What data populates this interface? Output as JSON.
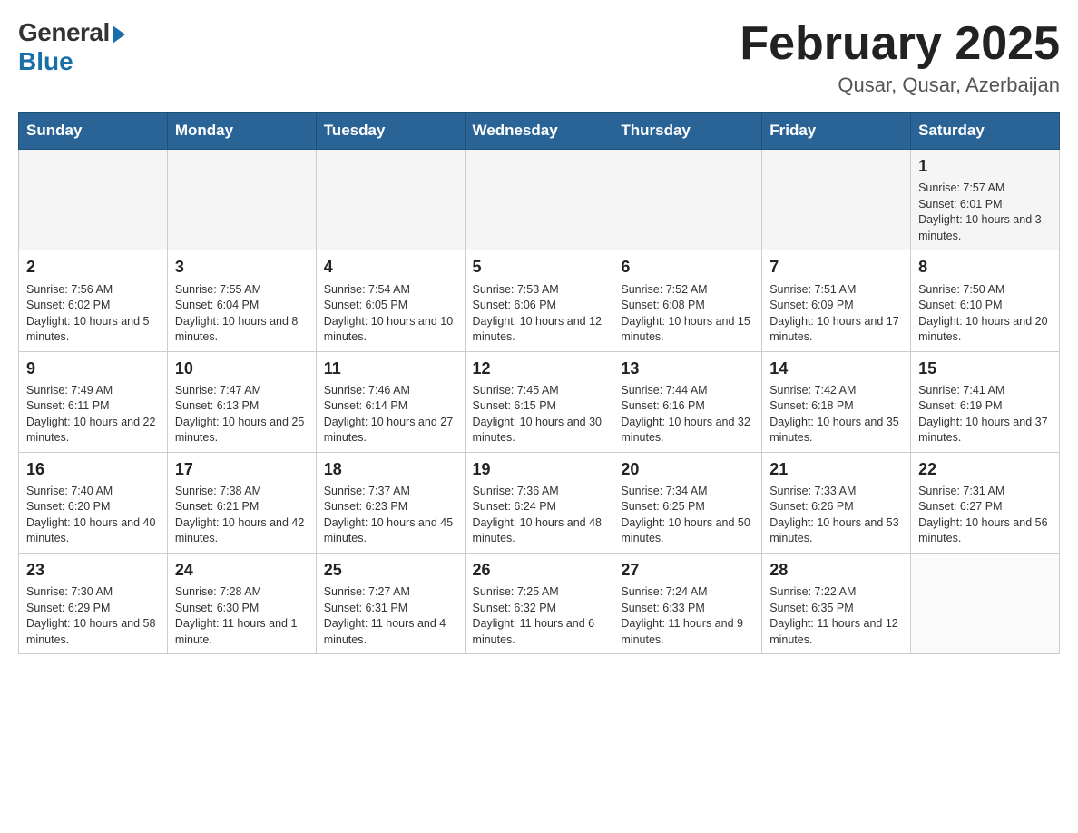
{
  "header": {
    "logo_general": "General",
    "logo_blue": "Blue",
    "title": "February 2025",
    "location": "Qusar, Qusar, Azerbaijan"
  },
  "days_of_week": [
    "Sunday",
    "Monday",
    "Tuesday",
    "Wednesday",
    "Thursday",
    "Friday",
    "Saturday"
  ],
  "weeks": [
    [
      {
        "day": "",
        "info": ""
      },
      {
        "day": "",
        "info": ""
      },
      {
        "day": "",
        "info": ""
      },
      {
        "day": "",
        "info": ""
      },
      {
        "day": "",
        "info": ""
      },
      {
        "day": "",
        "info": ""
      },
      {
        "day": "1",
        "info": "Sunrise: 7:57 AM\nSunset: 6:01 PM\nDaylight: 10 hours and 3 minutes."
      }
    ],
    [
      {
        "day": "2",
        "info": "Sunrise: 7:56 AM\nSunset: 6:02 PM\nDaylight: 10 hours and 5 minutes."
      },
      {
        "day": "3",
        "info": "Sunrise: 7:55 AM\nSunset: 6:04 PM\nDaylight: 10 hours and 8 minutes."
      },
      {
        "day": "4",
        "info": "Sunrise: 7:54 AM\nSunset: 6:05 PM\nDaylight: 10 hours and 10 minutes."
      },
      {
        "day": "5",
        "info": "Sunrise: 7:53 AM\nSunset: 6:06 PM\nDaylight: 10 hours and 12 minutes."
      },
      {
        "day": "6",
        "info": "Sunrise: 7:52 AM\nSunset: 6:08 PM\nDaylight: 10 hours and 15 minutes."
      },
      {
        "day": "7",
        "info": "Sunrise: 7:51 AM\nSunset: 6:09 PM\nDaylight: 10 hours and 17 minutes."
      },
      {
        "day": "8",
        "info": "Sunrise: 7:50 AM\nSunset: 6:10 PM\nDaylight: 10 hours and 20 minutes."
      }
    ],
    [
      {
        "day": "9",
        "info": "Sunrise: 7:49 AM\nSunset: 6:11 PM\nDaylight: 10 hours and 22 minutes."
      },
      {
        "day": "10",
        "info": "Sunrise: 7:47 AM\nSunset: 6:13 PM\nDaylight: 10 hours and 25 minutes."
      },
      {
        "day": "11",
        "info": "Sunrise: 7:46 AM\nSunset: 6:14 PM\nDaylight: 10 hours and 27 minutes."
      },
      {
        "day": "12",
        "info": "Sunrise: 7:45 AM\nSunset: 6:15 PM\nDaylight: 10 hours and 30 minutes."
      },
      {
        "day": "13",
        "info": "Sunrise: 7:44 AM\nSunset: 6:16 PM\nDaylight: 10 hours and 32 minutes."
      },
      {
        "day": "14",
        "info": "Sunrise: 7:42 AM\nSunset: 6:18 PM\nDaylight: 10 hours and 35 minutes."
      },
      {
        "day": "15",
        "info": "Sunrise: 7:41 AM\nSunset: 6:19 PM\nDaylight: 10 hours and 37 minutes."
      }
    ],
    [
      {
        "day": "16",
        "info": "Sunrise: 7:40 AM\nSunset: 6:20 PM\nDaylight: 10 hours and 40 minutes."
      },
      {
        "day": "17",
        "info": "Sunrise: 7:38 AM\nSunset: 6:21 PM\nDaylight: 10 hours and 42 minutes."
      },
      {
        "day": "18",
        "info": "Sunrise: 7:37 AM\nSunset: 6:23 PM\nDaylight: 10 hours and 45 minutes."
      },
      {
        "day": "19",
        "info": "Sunrise: 7:36 AM\nSunset: 6:24 PM\nDaylight: 10 hours and 48 minutes."
      },
      {
        "day": "20",
        "info": "Sunrise: 7:34 AM\nSunset: 6:25 PM\nDaylight: 10 hours and 50 minutes."
      },
      {
        "day": "21",
        "info": "Sunrise: 7:33 AM\nSunset: 6:26 PM\nDaylight: 10 hours and 53 minutes."
      },
      {
        "day": "22",
        "info": "Sunrise: 7:31 AM\nSunset: 6:27 PM\nDaylight: 10 hours and 56 minutes."
      }
    ],
    [
      {
        "day": "23",
        "info": "Sunrise: 7:30 AM\nSunset: 6:29 PM\nDaylight: 10 hours and 58 minutes."
      },
      {
        "day": "24",
        "info": "Sunrise: 7:28 AM\nSunset: 6:30 PM\nDaylight: 11 hours and 1 minute."
      },
      {
        "day": "25",
        "info": "Sunrise: 7:27 AM\nSunset: 6:31 PM\nDaylight: 11 hours and 4 minutes."
      },
      {
        "day": "26",
        "info": "Sunrise: 7:25 AM\nSunset: 6:32 PM\nDaylight: 11 hours and 6 minutes."
      },
      {
        "day": "27",
        "info": "Sunrise: 7:24 AM\nSunset: 6:33 PM\nDaylight: 11 hours and 9 minutes."
      },
      {
        "day": "28",
        "info": "Sunrise: 7:22 AM\nSunset: 6:35 PM\nDaylight: 11 hours and 12 minutes."
      },
      {
        "day": "",
        "info": ""
      }
    ]
  ]
}
